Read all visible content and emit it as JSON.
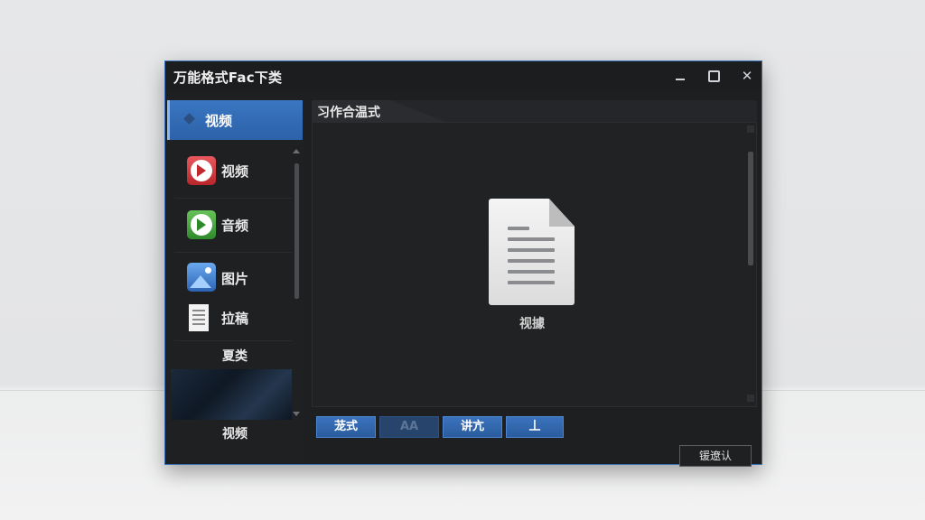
{
  "window": {
    "title": "万能格式Fac下类"
  },
  "sidebar": {
    "active_label": "视频",
    "items": [
      {
        "label": "视频",
        "icon": "video-play-icon"
      },
      {
        "label": "音频",
        "icon": "audio-play-icon"
      },
      {
        "label": "图片",
        "icon": "image-icon"
      },
      {
        "label": "拉稿",
        "icon": "document-icon"
      }
    ],
    "section_label": "夏类",
    "thumbnail_label": "视频"
  },
  "main": {
    "tab_label": "习作合温式",
    "document_caption": "视據"
  },
  "buttons": {
    "b1": "茏式",
    "b2": "AA",
    "b3": "讲亢",
    "b4": "丄",
    "ok": "锾遼认"
  },
  "colors": {
    "accent": "#3a76c2",
    "window_bg": "#1e1f21",
    "border": "#3a70b8"
  }
}
